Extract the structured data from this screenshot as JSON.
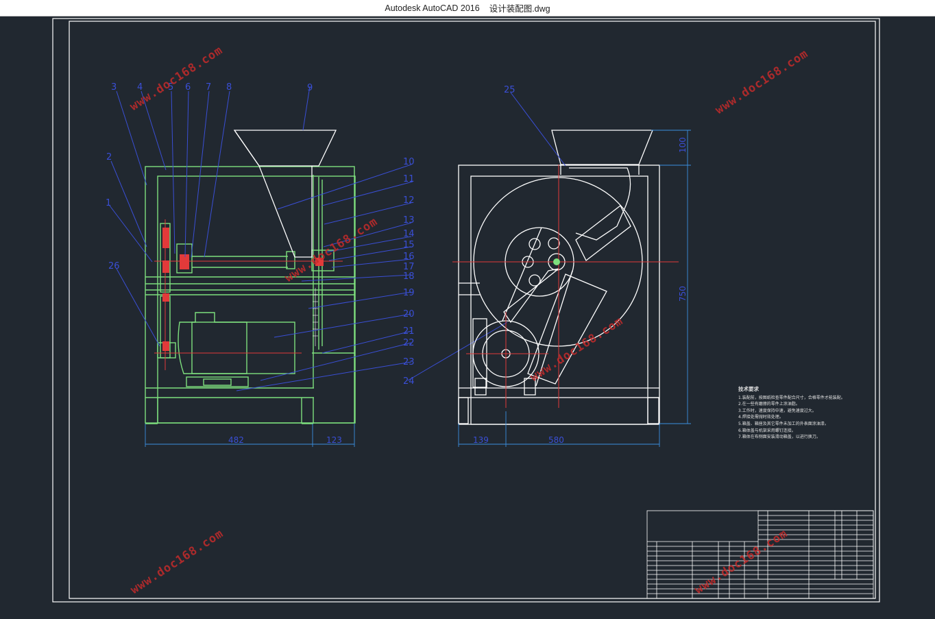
{
  "window": {
    "app_title": "Autodesk AutoCAD 2016",
    "file_name": "设计装配图.dwg"
  },
  "part_numbers": {
    "left_view": [
      "1",
      "2",
      "3",
      "4",
      "5",
      "6",
      "7",
      "8",
      "9",
      "10",
      "11",
      "12",
      "13",
      "14",
      "15",
      "16",
      "17",
      "18",
      "19",
      "20",
      "21",
      "22",
      "23",
      "24",
      "26"
    ],
    "right_view": [
      "25"
    ]
  },
  "dimensions": {
    "left_width": "482",
    "left_offset": "123",
    "right_left": "139",
    "right_width": "580",
    "right_height": "750",
    "hopper_height": "100"
  },
  "technical_requirements": {
    "heading": "技术要求",
    "items": [
      "1.装配前，按图纸检查零件配合尺寸，合格零件才能装配。",
      "2.在一些有磨擦的零件上涂油脂。",
      "3.工作时，速度保持中速，避免速度过大。",
      "4.焊接处需抛时效处理。",
      "5.箱盖、箱座及其它零件未加工的外表面涂油漆。",
      "6.箱体盖与机架采用螺钉连接。",
      "7.箱体在布侧面安装滑动箱盖，以进行换刀。"
    ]
  },
  "watermark": "www.doc168.com",
  "colors": {
    "background": "#212830",
    "frame": "#ffffff",
    "structure": "#7ee07e",
    "leader": "#3a4fd6",
    "centerline": "#e23a3a",
    "watermark": "#c52b2b"
  }
}
